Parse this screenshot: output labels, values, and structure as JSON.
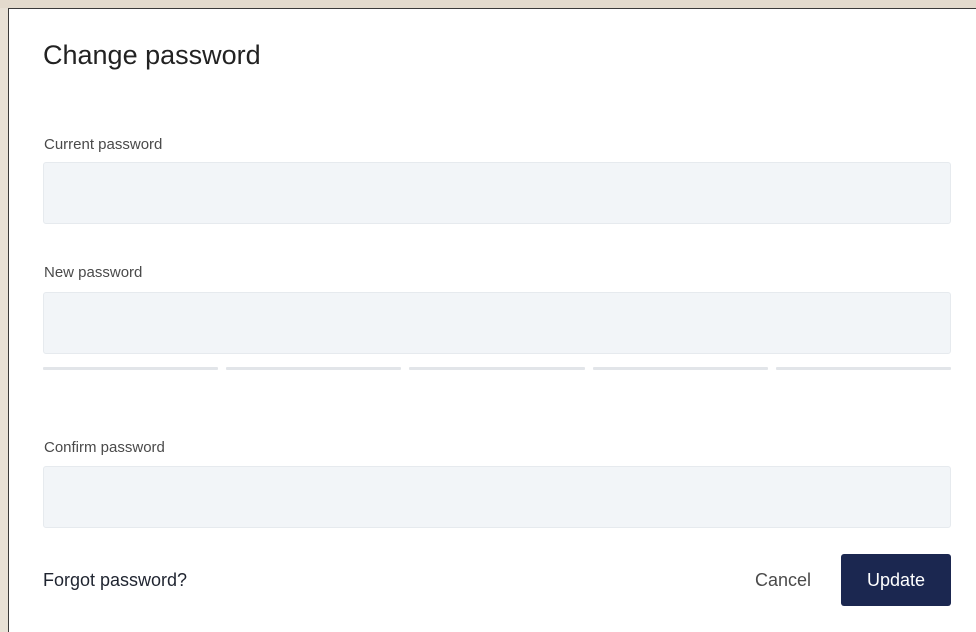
{
  "dialog": {
    "title": "Change password",
    "fields": [
      {
        "label": "Current password",
        "value": "",
        "placeholder": ""
      },
      {
        "label": "New password",
        "value": "",
        "placeholder": ""
      },
      {
        "label": "Confirm password",
        "value": "",
        "placeholder": ""
      }
    ],
    "strength_meter": {
      "segments": 5,
      "filled": 0
    },
    "forgot_link": "Forgot password?",
    "cancel_label": "Cancel",
    "update_label": "Update",
    "colors": {
      "primary_button": "#1b2750",
      "input_background": "#f2f5f8",
      "backdrop": "#e8e1d6"
    }
  }
}
